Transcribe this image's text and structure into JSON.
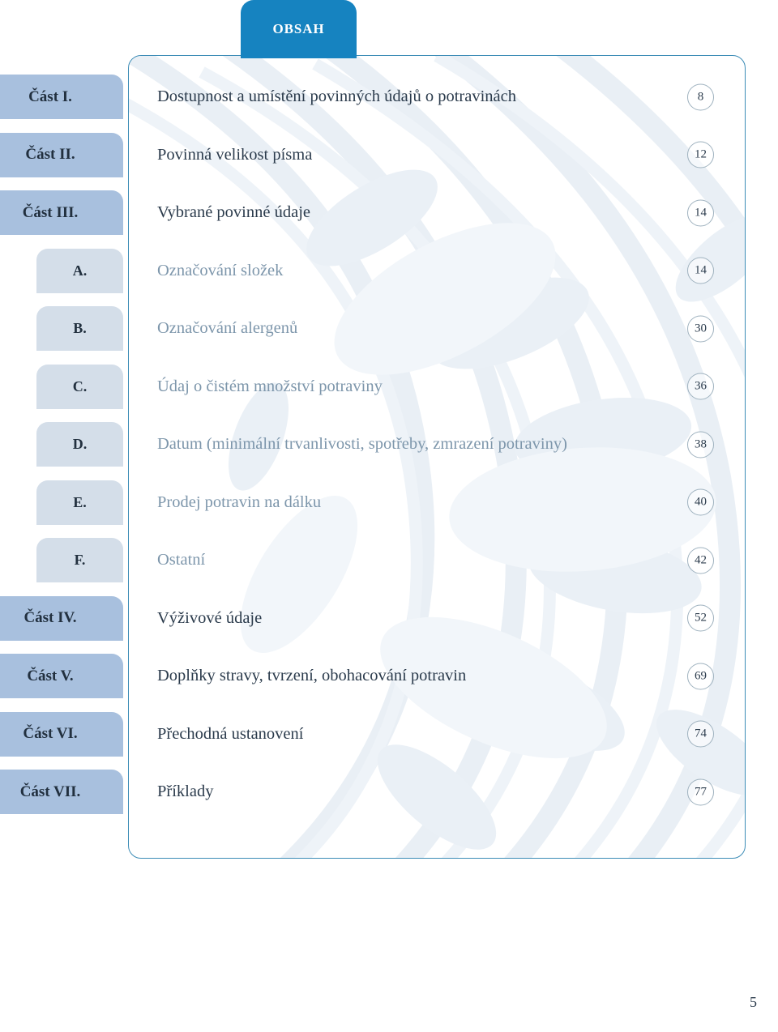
{
  "header": {
    "tab_label": "OBSAH"
  },
  "toc": {
    "entries": [
      {
        "tab": "Část I.",
        "tab_kind": "part",
        "title": "Dostupnost a umístění povinných údajů o potravinách",
        "page": "8",
        "level": "major"
      },
      {
        "tab": "Část II.",
        "tab_kind": "part",
        "title": "Povinná velikost písma",
        "page": "12",
        "level": "major"
      },
      {
        "tab": "Část III.",
        "tab_kind": "part",
        "title": "Vybrané povinné údaje",
        "page": "14",
        "level": "major"
      },
      {
        "tab": "A.",
        "tab_kind": "letter",
        "title": "Označování složek",
        "page": "14",
        "level": "minor"
      },
      {
        "tab": "B.",
        "tab_kind": "letter",
        "title": "Označování alergenů",
        "page": "30",
        "level": "minor"
      },
      {
        "tab": "C.",
        "tab_kind": "letter",
        "title": "Údaj o čistém množství potraviny",
        "page": "36",
        "level": "minor"
      },
      {
        "tab": "D.",
        "tab_kind": "letter",
        "title": "Datum (minimální trvanlivosti, spotřeby, zmrazení potraviny)",
        "page": "38",
        "level": "minor"
      },
      {
        "tab": "E.",
        "tab_kind": "letter",
        "title": "Prodej potravin na dálku",
        "page": "40",
        "level": "minor"
      },
      {
        "tab": "F.",
        "tab_kind": "letter",
        "title": "Ostatní",
        "page": "42",
        "level": "minor"
      },
      {
        "tab": "Část IV.",
        "tab_kind": "part",
        "title": "Výživové údaje",
        "page": "52",
        "level": "major"
      },
      {
        "tab": "Část V.",
        "tab_kind": "part",
        "title": "Doplňky stravy, tvrzení, obohacování potravin",
        "page": "69",
        "level": "major"
      },
      {
        "tab": "Část VI.",
        "tab_kind": "part",
        "title": "Přechodná ustanovení",
        "page": "74",
        "level": "major"
      },
      {
        "tab": "Část VII.",
        "tab_kind": "part",
        "title": "Příklady",
        "page": "77",
        "level": "major"
      }
    ]
  },
  "footer": {
    "folio": "5"
  },
  "colors": {
    "header_tab_bg": "#1683c0",
    "header_tab_text": "#ffffff",
    "panel_border": "#3c8cb6",
    "part_tab_bg": "#a8c0de",
    "letter_tab_bg": "#d4dee9",
    "tab_text": "#22303f",
    "major_title_text": "#2b3b4c",
    "minor_title_text": "#7d96ab",
    "page_badge_border": "#9fb2bf",
    "watermark": "#e8eef4",
    "page_bg": "#ffffff"
  }
}
